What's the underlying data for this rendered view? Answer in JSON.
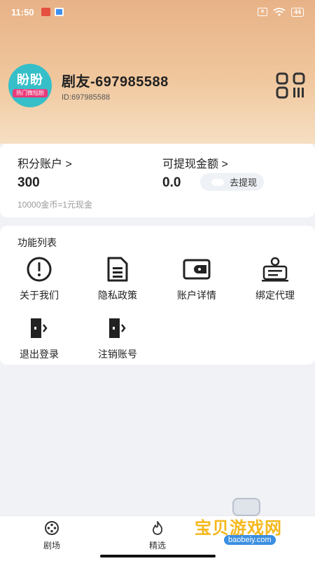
{
  "status_bar": {
    "time": "11:50",
    "battery": "44",
    "sim_icon": "no-sim-icon"
  },
  "profile": {
    "avatar_logo": "盼盼",
    "avatar_tag": "热门微短剧",
    "name": "剧友-697985588",
    "id": "ID:697985588"
  },
  "account": {
    "points_label": "积分账户 >",
    "points_value": "300",
    "withdraw_label": "可提现金额 >",
    "withdraw_value": "0.0",
    "withdraw_button": "去提现",
    "exchange_note": "10000金币=1元现金"
  },
  "functions": {
    "title": "功能列表",
    "items": [
      {
        "label": "关于我们",
        "icon": "info-icon"
      },
      {
        "label": "隐私政策",
        "icon": "document-icon"
      },
      {
        "label": "账户详情",
        "icon": "wallet-icon"
      },
      {
        "label": "绑定代理",
        "icon": "agent-icon"
      },
      {
        "label": "退出登录",
        "icon": "logout-icon"
      },
      {
        "label": "注销账号",
        "icon": "logout-icon"
      }
    ]
  },
  "nav": {
    "items": [
      {
        "label": "剧场",
        "icon": "film-reel-icon"
      },
      {
        "label": "精选",
        "icon": "flame-icon"
      }
    ]
  },
  "watermark": {
    "text": "宝贝游戏网",
    "url": "baobeiy.com"
  },
  "colors": {
    "header_top": "#e8b287",
    "header_bottom": "#f6dfc2",
    "avatar_bg": "#36bfc9",
    "avatar_tag": "#e83a7a",
    "page_bg": "#f0f2f6"
  }
}
